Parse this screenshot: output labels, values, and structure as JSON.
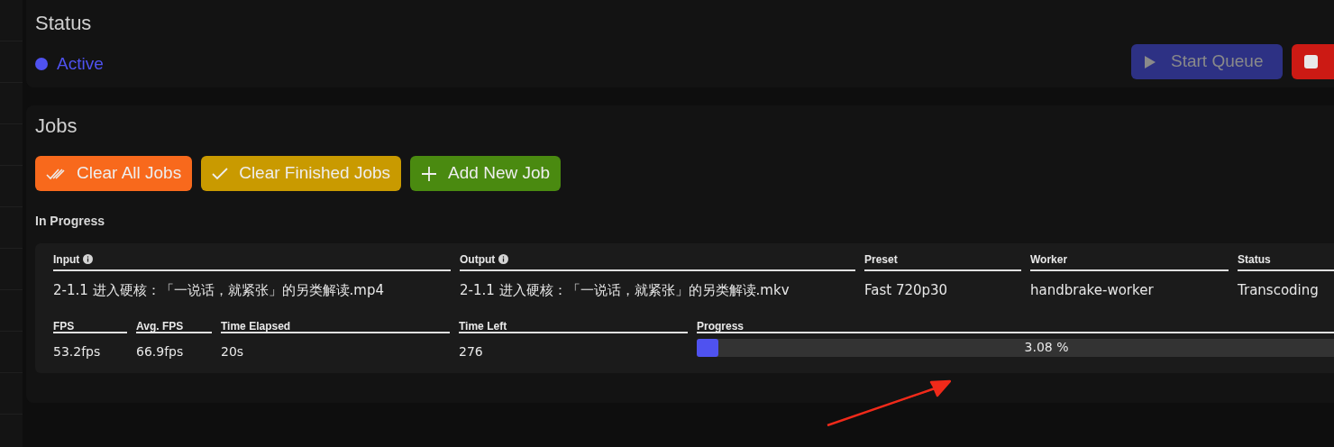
{
  "status": {
    "title": "Status",
    "indicator": {
      "label": "Active",
      "color": "#4f52f0"
    },
    "buttons": [
      {
        "kind": "start",
        "label": "Start Queue",
        "disabled": true
      },
      {
        "kind": "stop"
      }
    ]
  },
  "jobs": {
    "title": "Jobs",
    "actions": [
      {
        "kind": "clear_all",
        "label": "Clear All Jobs"
      },
      {
        "kind": "clear_finished",
        "label": "Clear Finished Jobs"
      },
      {
        "kind": "add",
        "label": "Add New Job"
      }
    ],
    "section": "In Progress",
    "job": {
      "fields": [
        {
          "label": "Input",
          "info": true,
          "value": "2-1.1 进入硬核：「一说话，就紧张」的另类解读.mp4"
        },
        {
          "label": "Output",
          "info": true,
          "value": "2-1.1 进入硬核：「一说话，就紧张」的另类解读.mkv"
        },
        {
          "label": "Preset",
          "info": false,
          "value": "Fast 720p30"
        },
        {
          "label": "Worker",
          "info": false,
          "value": "handbrake-worker"
        },
        {
          "label": "Status",
          "info": false,
          "value": "Transcoding"
        }
      ],
      "stats": [
        {
          "label": "FPS",
          "value": "53.2fps"
        },
        {
          "label": "Avg. FPS",
          "value": "66.9fps"
        },
        {
          "label": "Time Elapsed",
          "value": "20s"
        },
        {
          "label": "Time Left",
          "value": "276"
        }
      ],
      "progress": {
        "label": "Progress",
        "level": 0.0308,
        "reading": "3.08 %"
      }
    }
  }
}
